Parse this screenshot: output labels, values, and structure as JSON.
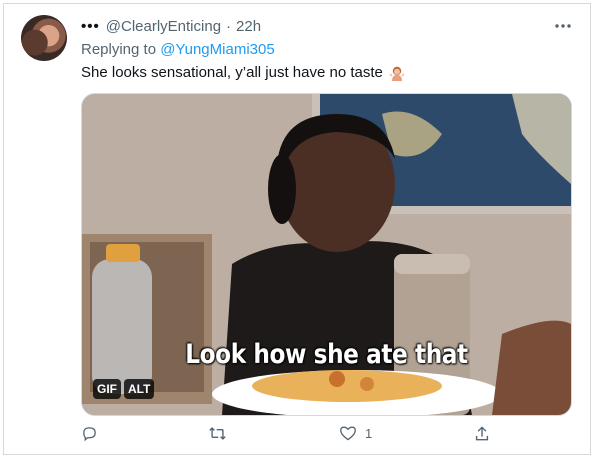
{
  "tweet": {
    "author": "@ClearlyEnticing",
    "separator": "·",
    "time": "22h",
    "more_icon": "more-horizontal-icon",
    "reply_prefix": "Replying to",
    "reply_to": "@YungMiami305",
    "text": "She looks sensational, y’all just have no taste",
    "emoji": "person-shrugging-emoji"
  },
  "media": {
    "caption": "Look how she ate that",
    "gif_label": "GIF",
    "alt_label": "ALT"
  },
  "actions": {
    "reply_icon": "reply-icon",
    "retweet_icon": "retweet-icon",
    "like_icon": "like-heart-icon",
    "like_count": "1",
    "share_icon": "share-icon"
  },
  "colors": {
    "accent": "#1d9bf0",
    "muted_text": "#536471",
    "primary_text": "#0f1419"
  }
}
